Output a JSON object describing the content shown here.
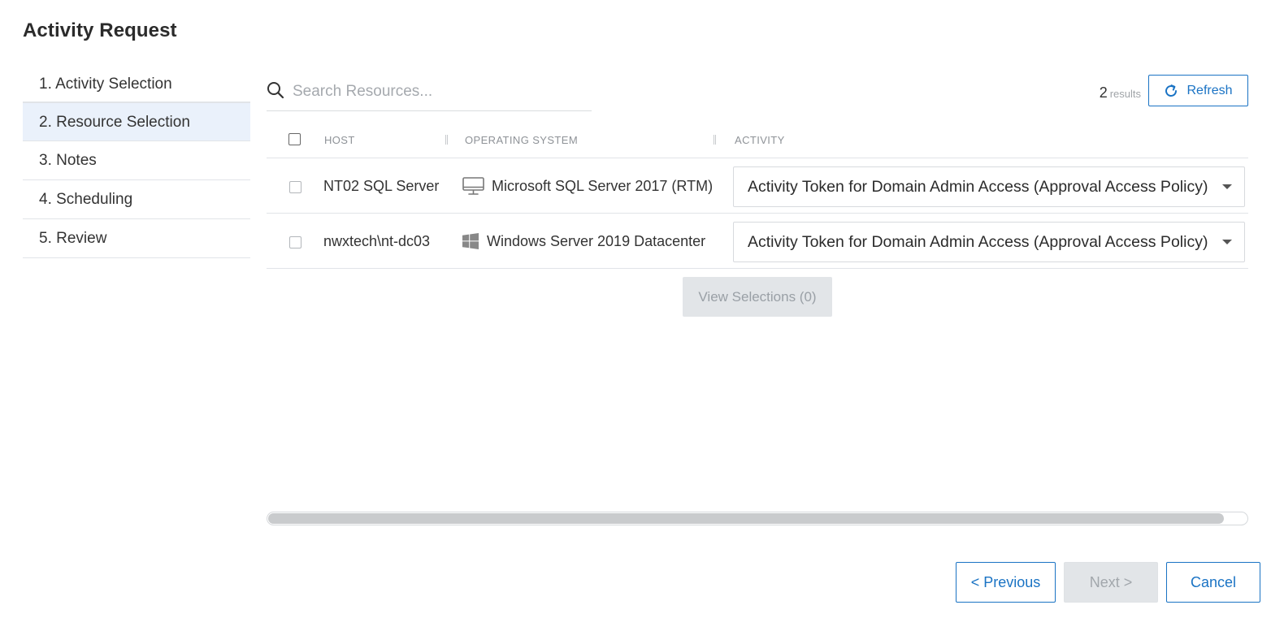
{
  "page": {
    "title": "Activity Request"
  },
  "steps": [
    {
      "label": "1. Activity Selection",
      "active": false
    },
    {
      "label": "2. Resource Selection",
      "active": true
    },
    {
      "label": "3. Notes",
      "active": false
    },
    {
      "label": "4. Scheduling",
      "active": false
    },
    {
      "label": "5. Review",
      "active": false
    }
  ],
  "search": {
    "placeholder": "Search Resources...",
    "value": "",
    "icon": "search-icon"
  },
  "results": {
    "count": "2",
    "label": "results"
  },
  "refresh": {
    "label": "Refresh",
    "icon": "refresh-icon"
  },
  "table": {
    "columns": {
      "host": "HOST",
      "os": "OPERATING SYSTEM",
      "activity": "ACTIVITY"
    },
    "rows": [
      {
        "host": "NT02 SQL Server",
        "os": "Microsoft SQL Server 2017 (RTM)",
        "os_icon": "monitor-icon",
        "activity": "Activity Token for Domain Admin Access (Approval Access Policy)",
        "selected": false
      },
      {
        "host": "nwxtech\\nt-dc03",
        "os": "Windows Server 2019 Datacenter",
        "os_icon": "windows-icon",
        "activity": "Activity Token for Domain Admin Access (Approval Access Policy)",
        "selected": false
      }
    ]
  },
  "view_selections": {
    "label": "View Selections (0)"
  },
  "footer": {
    "previous": "< Previous",
    "next": "Next >",
    "cancel": "Cancel"
  },
  "colors": {
    "accent": "#1a73c4",
    "active_step_bg": "#eaf1fb",
    "disabled_bg": "#e2e5e8"
  }
}
